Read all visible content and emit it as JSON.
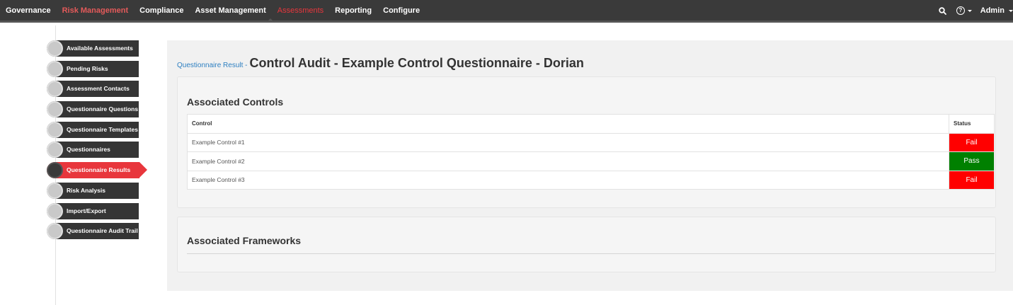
{
  "topnav": {
    "items": [
      {
        "label": "Governance",
        "style": "normal"
      },
      {
        "label": "Risk Management",
        "style": "red"
      },
      {
        "label": "Compliance",
        "style": "normal"
      },
      {
        "label": "Asset Management",
        "style": "normal"
      },
      {
        "label": "Assessments",
        "style": "active"
      },
      {
        "label": "Reporting",
        "style": "normal"
      },
      {
        "label": "Configure",
        "style": "normal"
      }
    ],
    "search_icon": "search-icon",
    "help_icon": "help-icon",
    "user_label": "Admin"
  },
  "sidebar": {
    "items": [
      {
        "label": "Available Assessments"
      },
      {
        "label": "Pending Risks"
      },
      {
        "label": "Assessment Contacts"
      },
      {
        "label": "Questionnaire Questions"
      },
      {
        "label": "Questionnaire Templates"
      },
      {
        "label": "Questionnaires"
      },
      {
        "label": "Questionnaire Results",
        "active": true
      },
      {
        "label": "Risk Analysis"
      },
      {
        "label": "Import/Export"
      },
      {
        "label": "Questionnaire Audit Trail"
      }
    ]
  },
  "main": {
    "breadcrumb": "Questionnaire Result -",
    "title": "Control Audit - Example Control Questionnaire - Dorian",
    "controls": {
      "heading": "Associated Controls",
      "columns": [
        "Control",
        "Status"
      ],
      "rows": [
        {
          "control": "Example Control #1",
          "status": "Fail"
        },
        {
          "control": "Example Control #2",
          "status": "Pass"
        },
        {
          "control": "Example Control #3",
          "status": "Fail"
        }
      ]
    },
    "frameworks": {
      "heading": "Associated Frameworks"
    }
  },
  "colors": {
    "accent": "#e8363c",
    "fail": "#ff0000",
    "pass": "#008000",
    "nav_bg": "#3a3a3a",
    "link": "#2d7fc1"
  }
}
